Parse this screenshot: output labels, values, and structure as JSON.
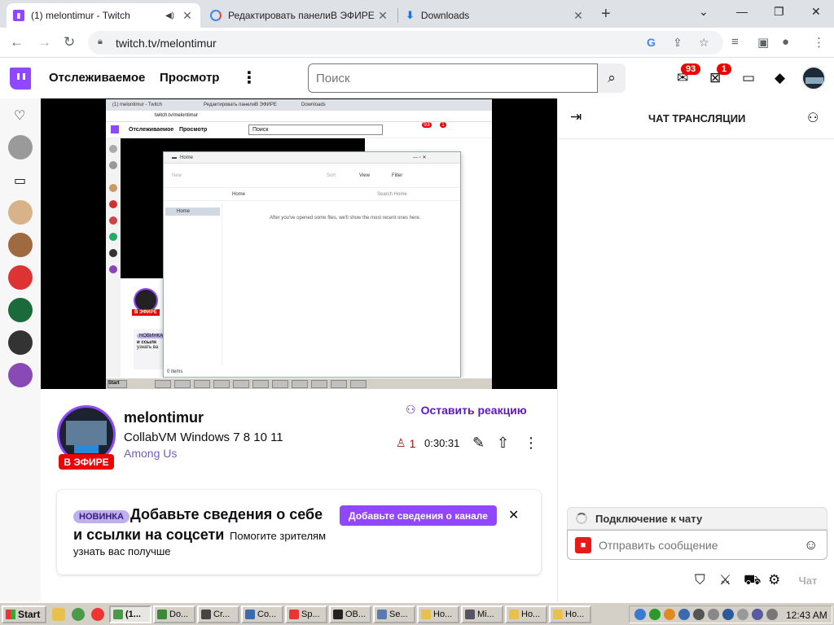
{
  "browser": {
    "tabs": [
      {
        "title": "(1) melontimur - Twitch",
        "icon": "twitch-icon",
        "active": true
      },
      {
        "title": "Редактировать панелиВ ЭФИРЕ",
        "icon": "google-icon",
        "active": false
      },
      {
        "title": "Downloads",
        "icon": "download-icon",
        "active": false
      }
    ],
    "url": "twitch.tv/melontimur"
  },
  "twitch_nav": {
    "following": "Отслеживаемое",
    "browse": "Просмотр",
    "search_placeholder": "Поиск",
    "notifications_count": "93",
    "inbox_count": "1"
  },
  "stream_preview": {
    "explorer_title": "Home",
    "explorer_message": "After you've opened some files, we'll show the most recent ones here.",
    "explorer_search": "Search Home",
    "explorer_nav": "Home",
    "explorer_status": "0 items",
    "explorer_toolbar": {
      "new": "New",
      "sort": "Sort",
      "view": "View",
      "filter": "Filter"
    },
    "mini_live": "В ЭФИРЕ",
    "mini_new": "НОВИНКА",
    "mini_card_text": "и ссылк",
    "mini_card_sub": "узнать ва",
    "mini_tabs": [
      "(1) melontimur - Twitch",
      "Редактировать панелиВ ЭФИРЕ",
      "Downloads"
    ],
    "mini_url": "twitch.tv/melontimur",
    "mini_nav": {
      "following": "Отслеживаемое",
      "browse": "Просмотр",
      "search": "Поиск",
      "notif": "93",
      "inbox": "1"
    },
    "mini_start": "Start"
  },
  "channel": {
    "name": "melontimur",
    "title": "CollabVM Windows 7 8 10 11",
    "game": "Among Us",
    "live_label": "В ЭФИРЕ",
    "react_label": "Оставить реакцию",
    "viewers": "1",
    "uptime": "0:30:31"
  },
  "promo": {
    "pill": "НОВИНКА",
    "headline_1": "Добавьте сведения о себе",
    "headline_2": "и ссылки на соцсети",
    "sub_1": "Помогите зрителям",
    "sub_2": "узнать вас получше",
    "cta": "Добавьте сведения о канале"
  },
  "chat": {
    "title": "ЧАТ ТРАНСЛЯЦИИ",
    "status": "Подключение к чату",
    "placeholder": "Отправить сообщение",
    "send": "Чат"
  },
  "taskbar": {
    "start": "Start",
    "buttons": [
      "(1...",
      "Do...",
      "Cr...",
      "Co...",
      "Sp...",
      "OB...",
      "Se...",
      "Ho...",
      "Mi...",
      "Ho...",
      "Ho..."
    ],
    "clock": "12:43 AM"
  },
  "colors": {
    "twitch_purple": "#9147ff",
    "live_red": "#eb0400",
    "game_link": "#755ebc"
  }
}
